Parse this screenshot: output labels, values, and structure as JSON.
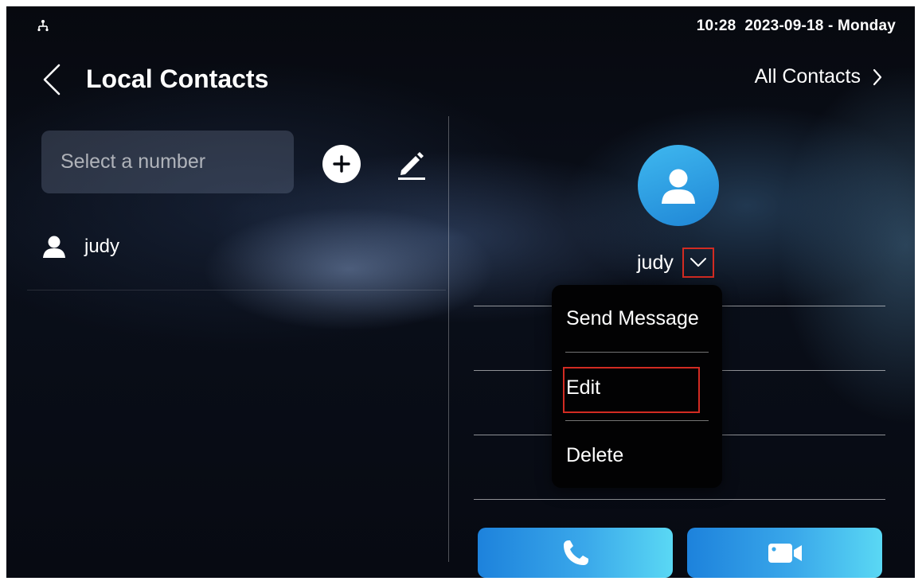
{
  "status_bar": {
    "network_icon": "network-icon",
    "datetime": "10:28  2023-09-18 - Monday"
  },
  "header": {
    "back_icon": "chevron-left-icon",
    "title": "Local Contacts",
    "all_contacts_label": "All Contacts",
    "all_contacts_icon": "chevron-right-icon"
  },
  "left_panel": {
    "search_placeholder": "Select a number",
    "add_icon": "plus-circle-icon",
    "edit_icon": "pencil-icon",
    "contacts": [
      {
        "name": "judy",
        "icon": "person-icon"
      }
    ]
  },
  "detail": {
    "avatar_icon": "person-icon",
    "name": "judy",
    "dropdown_icon": "chevron-down-icon"
  },
  "menu": {
    "items": [
      {
        "label": "Send Message"
      },
      {
        "label": "Edit"
      },
      {
        "label": "Delete"
      }
    ]
  },
  "actions": {
    "audio_call_icon": "phone-icon",
    "video_call_icon": "video-camera-icon"
  },
  "colors": {
    "accent_blue": "#1f86d6",
    "highlight_red": "#d22b22"
  }
}
